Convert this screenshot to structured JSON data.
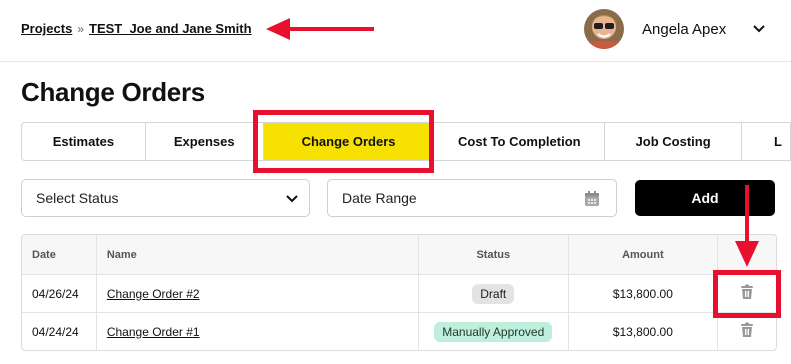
{
  "header": {
    "breadcrumb_root": "Projects",
    "breadcrumb_separator": "»",
    "breadcrumb_current": "TEST_Joe and Jane Smith",
    "user_name": "Angela Apex"
  },
  "page": {
    "title": "Change Orders"
  },
  "tabs": [
    {
      "label": "Estimates",
      "active": false
    },
    {
      "label": "Expenses",
      "active": false
    },
    {
      "label": "Change Orders",
      "active": true
    },
    {
      "label": "Cost To Completion",
      "active": false
    },
    {
      "label": "Job Costing",
      "active": false
    },
    {
      "label": "L",
      "active": false
    }
  ],
  "filters": {
    "status_label": "Select Status",
    "date_label": "Date Range",
    "add_label": "Add"
  },
  "table": {
    "headers": {
      "date": "Date",
      "name": "Name",
      "status": "Status",
      "amount": "Amount"
    },
    "rows": [
      {
        "date": "04/26/24",
        "name": "Change Order #2",
        "status": "Draft",
        "amount": "$13,800.00"
      },
      {
        "date": "04/24/24",
        "name": "Change Order #1",
        "status": "Manually Approved",
        "amount": "$13,800.00"
      }
    ]
  },
  "colors": {
    "accent_yellow": "#f6e100",
    "annotation_red": "#e8102e",
    "button_black": "#000000",
    "badge_draft": "#e3e3e3",
    "badge_approved": "#bfeedd"
  },
  "icons": [
    "chevron-down-icon",
    "calendar-icon",
    "trash-icon",
    "breadcrumb-separator-icon"
  ]
}
